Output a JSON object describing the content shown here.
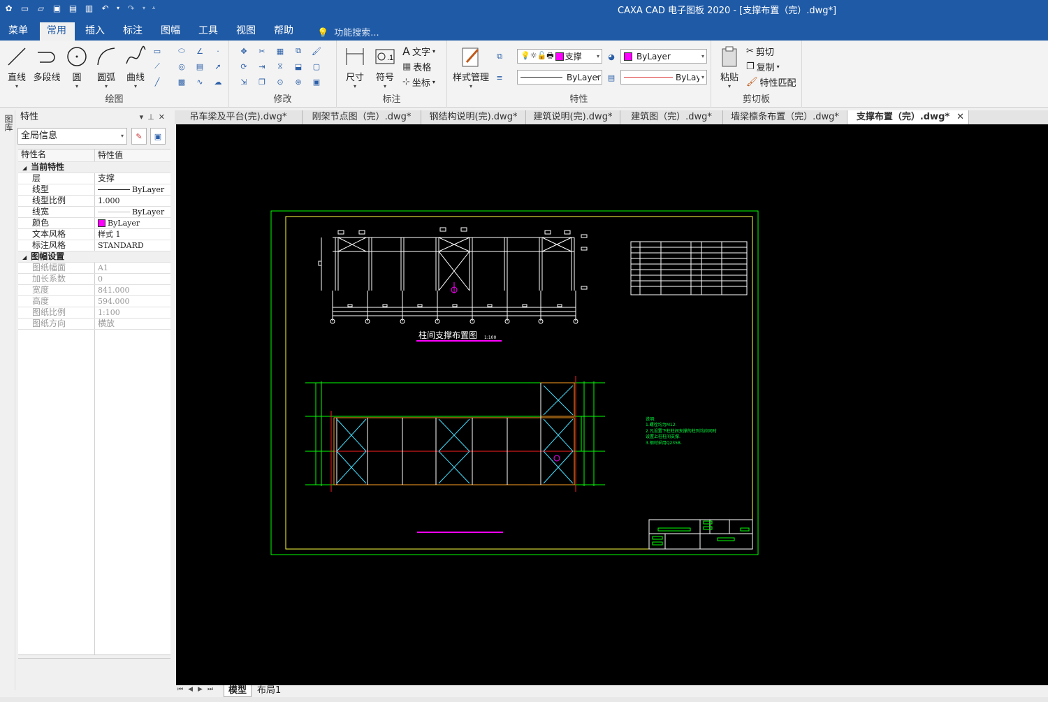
{
  "window": {
    "title": "CAXA CAD 电子图板 2020 - [支撑布置（完）.dwg*]"
  },
  "menu": {
    "tabs": [
      "菜单",
      "常用",
      "插入",
      "标注",
      "图幅",
      "工具",
      "视图",
      "帮助"
    ],
    "active_tab": "常用",
    "search_placeholder": "功能搜索..."
  },
  "ribbon": {
    "draw": {
      "label": "绘图",
      "line": "直线",
      "polyline": "多段线",
      "circle": "圆",
      "arc": "圆弧",
      "curve": "曲线"
    },
    "modify": {
      "label": "修改"
    },
    "annotate": {
      "label": "标注",
      "dimension": "尺寸",
      "symbol": "符号",
      "text": "文字",
      "table": "表格",
      "coordinate": "坐标"
    },
    "style": {
      "label": "样式管理"
    },
    "properties": {
      "label": "特性",
      "layer": "支撑",
      "color": "ByLayer",
      "linetype": "ByLayer",
      "lineweight": "ByLayer",
      "color_hex": "#ff00ff"
    },
    "clipboard": {
      "label": "剪切板",
      "paste": "粘贴",
      "cut": "剪切",
      "copy": "复制",
      "match": "特性匹配"
    }
  },
  "panel": {
    "side_label": "图库",
    "title": "特性",
    "scope": "全局信息",
    "col_name": "特性名",
    "col_value": "特性值",
    "categories": [
      {
        "name": "当前特性",
        "rows": [
          {
            "k": "层",
            "v": "支撑"
          },
          {
            "k": "线型",
            "v": "ByLayer"
          },
          {
            "k": "线型比例",
            "v": "1.000"
          },
          {
            "k": "线宽",
            "v": "ByLayer"
          },
          {
            "k": "颜色",
            "v": "ByLayer"
          },
          {
            "k": "文本风格",
            "v": "样式 1"
          },
          {
            "k": "标注风格",
            "v": "STANDARD"
          }
        ]
      },
      {
        "name": "图幅设置",
        "rows": [
          {
            "k": "图纸幅面",
            "v": "A1"
          },
          {
            "k": "加长系数",
            "v": "0"
          },
          {
            "k": "宽度",
            "v": "841.000"
          },
          {
            "k": "高度",
            "v": "594.000"
          },
          {
            "k": "图纸比例",
            "v": "1:100"
          },
          {
            "k": "图纸方向",
            "v": "横放"
          }
        ]
      }
    ]
  },
  "doc_tabs": [
    "吊车梁及平台(完).dwg*",
    "刚架节点图（完）.dwg*",
    "钢结构说明(完).dwg*",
    "建筑说明(完).dwg*",
    "建筑图（完）.dwg*",
    "墙梁檩条布置（完）.dwg*",
    "支撑布置（完）.dwg*"
  ],
  "active_doc": "支撑布置（完）.dwg*",
  "drawing": {
    "elevation_title": "柱间支撑布置图",
    "elevation_scale": "1:100",
    "notes": [
      "说明:",
      "1.螺栓均为M12.",
      "2.凡设置下柱柱间支撑的柱列均应同时",
      "  设置上柱柱间支撑.",
      "3.钢材采用Q235B."
    ]
  },
  "layout_tabs": [
    "模型",
    "布局1"
  ],
  "active_layout": "模型"
}
